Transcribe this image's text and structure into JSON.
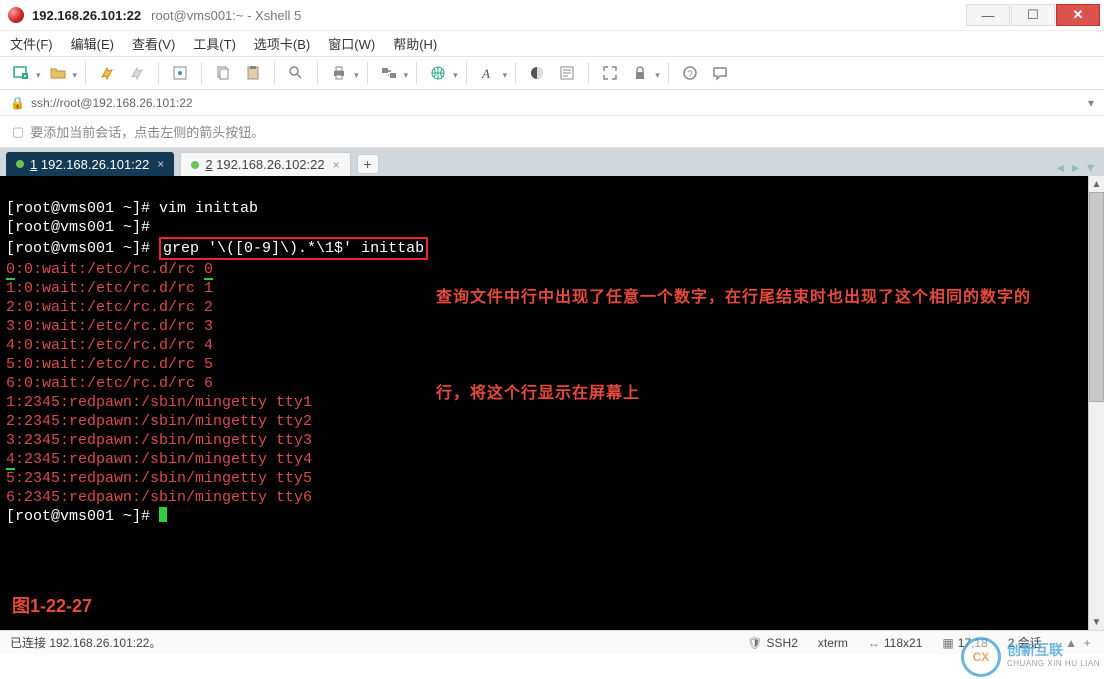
{
  "title": {
    "host": "192.168.26.101:22",
    "sub": "root@vms001:~ - Xshell 5"
  },
  "menu": {
    "file": "文件(F)",
    "edit": "编辑(E)",
    "view": "查看(V)",
    "tools": "工具(T)",
    "tabs": "选项卡(B)",
    "window": "窗口(W)",
    "help": "帮助(H)"
  },
  "address": {
    "url": "ssh://root@192.168.26.101:22"
  },
  "info": {
    "text": "要添加当前会话，点击左侧的箭头按钮。"
  },
  "tabs": {
    "active": {
      "num": "1",
      "label": "192.168.26.101:22"
    },
    "inactive": {
      "num": "2",
      "label": "192.168.26.102:22"
    },
    "add": "+"
  },
  "terminal": {
    "l1_prompt": "[root@vms001 ~]# ",
    "l1_cmd": "vim inittab",
    "l2": "[root@vms001 ~]#",
    "l3_prompt": "[root@vms001 ~]# ",
    "l3_cmd": "grep '\\([0-9]\\).*\\1$' inittab",
    "out": [
      "0:0:wait:/etc/rc.d/rc 0",
      "1:0:wait:/etc/rc.d/rc 1",
      "2:0:wait:/etc/rc.d/rc 2",
      "3:0:wait:/etc/rc.d/rc 3",
      "4:0:wait:/etc/rc.d/rc 4",
      "5:0:wait:/etc/rc.d/rc 5",
      "6:0:wait:/etc/rc.d/rc 6",
      "1:2345:redpawn:/sbin/mingetty tty1",
      "2:2345:redpawn:/sbin/mingetty tty2",
      "3:2345:redpawn:/sbin/mingetty tty3",
      "4:2345:redpawn:/sbin/mingetty tty4",
      "5:2345:redpawn:/sbin/mingetty tty5",
      "6:2345:redpawn:/sbin/mingetty tty6"
    ],
    "l_last": "[root@vms001 ~]# ",
    "annotation_l1": "查询文件中行中出现了任意一个数字，在行尾结束时也出现了这个相同的数字的",
    "annotation_l2": "行，将这个行显示在屏幕上",
    "fig_label": "图1-22-27"
  },
  "status": {
    "conn": "已连接 192.168.26.101:22。",
    "proto": "SSH2",
    "term": "xterm",
    "size": "118x21",
    "pos": "17,18",
    "sessions": "2 会话"
  },
  "watermark": {
    "brand_cn": "创新互联",
    "brand_en": "CHUANG XIN HU LIAN",
    "mark": "CX"
  }
}
